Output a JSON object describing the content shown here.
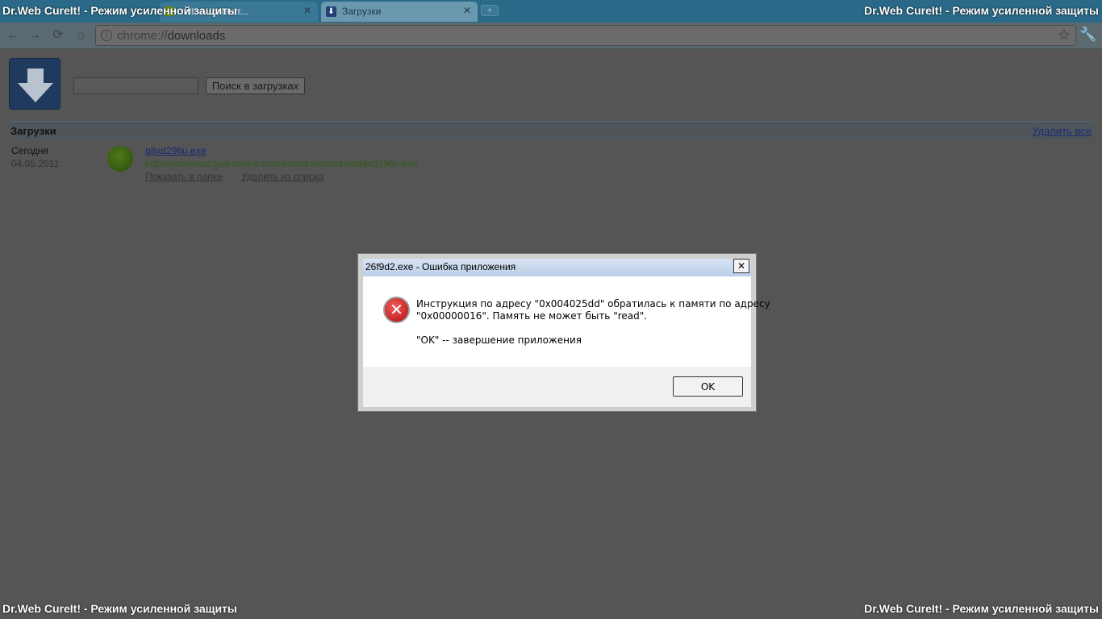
{
  "banners": {
    "text": "Dr.Web CureIt! - Режим усиленной защиты"
  },
  "tabs": [
    {
      "label": "relt! — скачат..."
    },
    {
      "label": "Загрузки"
    }
  ],
  "toolbar": {
    "url_scheme": "chrome://",
    "url_host": "downloads"
  },
  "downloads": {
    "search_placeholder": "",
    "search_button": "Поиск в загрузках",
    "section_title": "Загрузки",
    "clear_all": "Удалить все",
    "date_label": "Сегодня",
    "date_value": "04.05.2011",
    "item": {
      "file_name": "q8xd296u.exe",
      "url": "http://download.geo.drweb.com/pub/drweb/cureit/q8xd296u.exe",
      "show_in_folder": "Показать в папке",
      "remove_from_list": "Удалить из списка"
    }
  },
  "dialog": {
    "title": "26f9d2.exe - Ошибка приложения",
    "close_label": "✕",
    "line1": "Инструкция по адресу \"0x004025dd\" обратилась к памяти по адресу",
    "line2": "\"0x00000016\". Память не может быть \"read\".",
    "line3": "\"OK\" -- завершение приложения",
    "ok_button": "OK"
  },
  "colors": {
    "dim_overlay": "#555555",
    "banner_text": "#ffffff",
    "error_red": "#c81c1c",
    "link_blue": "#1a2676",
    "url_green": "#2e5b16"
  },
  "icons": {
    "error": "error-icon",
    "download_logo": "download-arrow-icon",
    "file": "drweb-lion-icon"
  }
}
